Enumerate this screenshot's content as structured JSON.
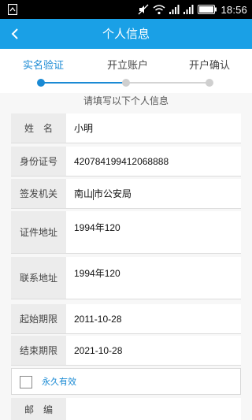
{
  "status_bar": {
    "time": "18:56",
    "icons": [
      "notification-icon",
      "mute-icon",
      "wifi-icon",
      "signal-icon",
      "signal-icon",
      "battery-icon"
    ]
  },
  "header": {
    "title": "个人信息",
    "back_icon": "chevron-left-icon"
  },
  "steps": [
    {
      "label": "实名验证",
      "state": "active"
    },
    {
      "label": "开立账户",
      "state": "pending"
    },
    {
      "label": "开户确认",
      "state": "pending"
    }
  ],
  "hint": "请填写以下个人信息",
  "form": {
    "name": {
      "label": "姓　名",
      "value": "小明"
    },
    "id_number": {
      "label": "身份证号",
      "value": "420784199412068888"
    },
    "authority": {
      "label": "签发机关",
      "value_before_caret": "南山",
      "value_after_caret": "市公安局"
    },
    "id_address": {
      "label": "证件地址",
      "value": "1994年120"
    },
    "contact_address": {
      "label": "联系地址",
      "value": "1994年120"
    },
    "start_date": {
      "label": "起始期限",
      "value": "2011-10-28"
    },
    "end_date": {
      "label": "结束期限",
      "value": "2021-10-28"
    },
    "permanent": {
      "label": "永久有效",
      "checked": false
    },
    "zip": {
      "label": "邮　编",
      "value": ""
    }
  },
  "colors": {
    "accent": "#1aa0e6",
    "step_active": "#1a8ad4",
    "label_bg": "#ececec"
  }
}
